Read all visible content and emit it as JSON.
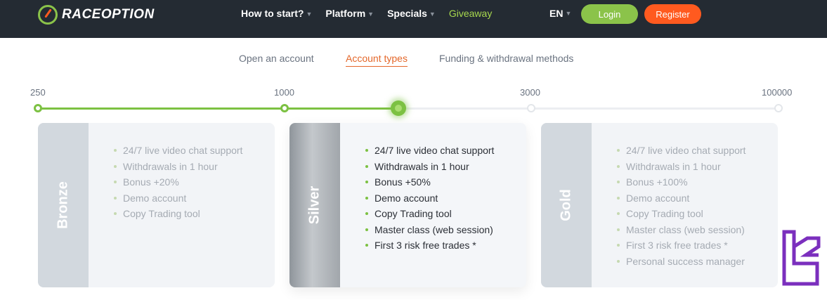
{
  "header": {
    "logo_text_1": "RACE",
    "logo_text_2": "OPTION",
    "nav": [
      {
        "label": "How to start?",
        "has_dropdown": true
      },
      {
        "label": "Platform",
        "has_dropdown": true
      },
      {
        "label": "Specials",
        "has_dropdown": true
      },
      {
        "label": "Giveaway",
        "has_dropdown": false
      }
    ],
    "language": "EN",
    "login_label": "Login",
    "register_label": "Register"
  },
  "tabs": [
    {
      "label": "Open an account",
      "active": false
    },
    {
      "label": "Account types",
      "active": true
    },
    {
      "label": "Funding & withdrawal methods",
      "active": false
    }
  ],
  "slider": {
    "ticks": [
      "250",
      "1000",
      "3000",
      "100000"
    ],
    "selected_fraction": 0.485
  },
  "cards": [
    {
      "name": "Bronze",
      "active": false,
      "features": [
        "24/7 live video chat support",
        "Withdrawals in 1 hour",
        "Bonus +20%",
        "Demo account",
        "Copy Trading tool"
      ]
    },
    {
      "name": "Silver",
      "active": true,
      "features": [
        "24/7 live video chat support",
        "Withdrawals in 1 hour",
        "Bonus +50%",
        "Demo account",
        "Copy Trading tool",
        "Master class (web session)",
        "First 3 risk free trades *"
      ]
    },
    {
      "name": "Gold",
      "active": false,
      "features": [
        "24/7 live video chat support",
        "Withdrawals in 1 hour",
        "Bonus +100%",
        "Demo account",
        "Copy Trading tool",
        "Master class (web session)",
        "First 3 risk free trades *",
        "Personal success manager"
      ]
    }
  ],
  "colors": {
    "header_bg": "#242b33",
    "accent_green": "#7cc142",
    "accent_orange": "#ff5a1f",
    "tab_active": "#e4672a",
    "watermark": "#7b2fbe"
  }
}
